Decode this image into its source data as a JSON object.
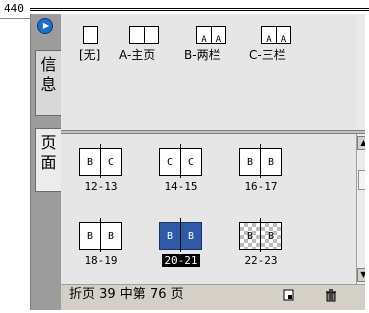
{
  "ruler": {
    "value": "440"
  },
  "side_tabs": [
    {
      "label": "信\n息"
    },
    {
      "label": "页\n面"
    }
  ],
  "masters": [
    {
      "label": "[无]",
      "pages": 1,
      "letters": [
        "",
        ""
      ]
    },
    {
      "label": "A-主页",
      "pages": 2,
      "letters": [
        "",
        ""
      ]
    },
    {
      "label": "B-两栏",
      "pages": 2,
      "letters": [
        "A",
        "A"
      ]
    },
    {
      "label": "C-三栏",
      "pages": 2,
      "letters": [
        "A",
        "A"
      ]
    }
  ],
  "spreads": [
    {
      "label": "12-13",
      "left": "B",
      "right": "C",
      "state": "normal"
    },
    {
      "label": "14-15",
      "left": "C",
      "right": "C",
      "state": "normal"
    },
    {
      "label": "16-17",
      "left": "B",
      "right": "B",
      "state": "normal"
    },
    {
      "label": "18-19",
      "left": "B",
      "right": "B",
      "state": "normal"
    },
    {
      "label": "20-21",
      "left": "B",
      "right": "B",
      "state": "selected"
    },
    {
      "label": "22-23",
      "left": "B",
      "right": "B",
      "state": "checker"
    }
  ],
  "status": {
    "text": "折页 39 中第 76 页"
  },
  "colors": {
    "selection": "#2f5aa8",
    "panel_bg": "#d4d0c8",
    "tab_bg": "#9c9c9c",
    "arrow": "#1a6fd1"
  },
  "icons": {
    "expand": "arrow-right-icon",
    "new_page": "new-page-icon",
    "delete": "trash-icon"
  }
}
